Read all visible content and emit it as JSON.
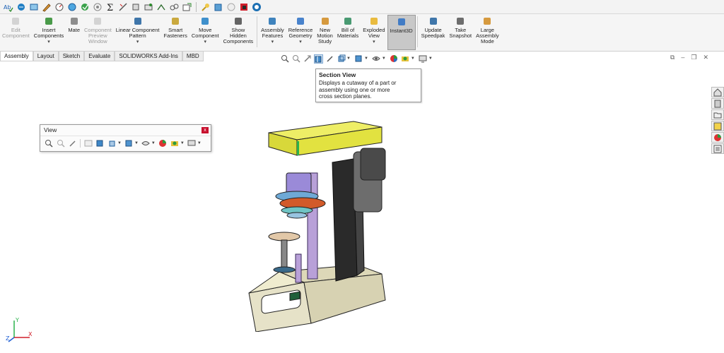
{
  "ribbon": {
    "buttons": [
      {
        "id": "edit-component",
        "label": "Edit\nComponent",
        "disabled": true
      },
      {
        "id": "insert-components",
        "label": "Insert\nComponents",
        "drop": true
      },
      {
        "id": "mate",
        "label": "Mate"
      },
      {
        "id": "component-preview",
        "label": "Component\nPreview\nWindow",
        "disabled": true
      },
      {
        "id": "linear-pattern",
        "label": "Linear Component\nPattern",
        "drop": true
      },
      {
        "id": "smart-fasteners",
        "label": "Smart\nFasteners"
      },
      {
        "id": "move-component",
        "label": "Move\nComponent",
        "drop": true
      },
      {
        "id": "show-hidden",
        "label": "Show\nHidden\nComponents"
      },
      {
        "id": "assembly-features",
        "label": "Assembly\nFeatures",
        "drop": true
      },
      {
        "id": "reference-geometry",
        "label": "Reference\nGeometry",
        "drop": true
      },
      {
        "id": "new-motion-study",
        "label": "New\nMotion\nStudy"
      },
      {
        "id": "bill-of-materials",
        "label": "Bill of\nMaterials"
      },
      {
        "id": "exploded-view",
        "label": "Exploded\nView",
        "drop": true
      },
      {
        "id": "instant3d",
        "label": "Instant3D",
        "active": true
      },
      {
        "id": "update-speedpak",
        "label": "Update\nSpeedpak"
      },
      {
        "id": "take-snapshot",
        "label": "Take\nSnapshot"
      },
      {
        "id": "large-assembly",
        "label": "Large\nAssembly\nMode"
      }
    ]
  },
  "tabs": [
    "Assembly",
    "Layout",
    "Sketch",
    "Evaluate",
    "SOLIDWORKS Add-Ins",
    "MBD"
  ],
  "tooltip": {
    "title": "Section View",
    "body": "Displays a cutaway of a part or\nassembly using one or more\ncross section planes."
  },
  "view_panel": {
    "title": "View",
    "close": "x"
  },
  "triad": {
    "x": "X",
    "y": "Y",
    "z": "Z"
  },
  "colors": {
    "housing_yellow": "#e2e240",
    "base_beige": "#e6e2c8",
    "column_dark": "#2a2a2a",
    "motor_gray": "#6d6d6d",
    "accent_green": "#2bb24c",
    "shaft_purple": "#b8a0d8"
  }
}
